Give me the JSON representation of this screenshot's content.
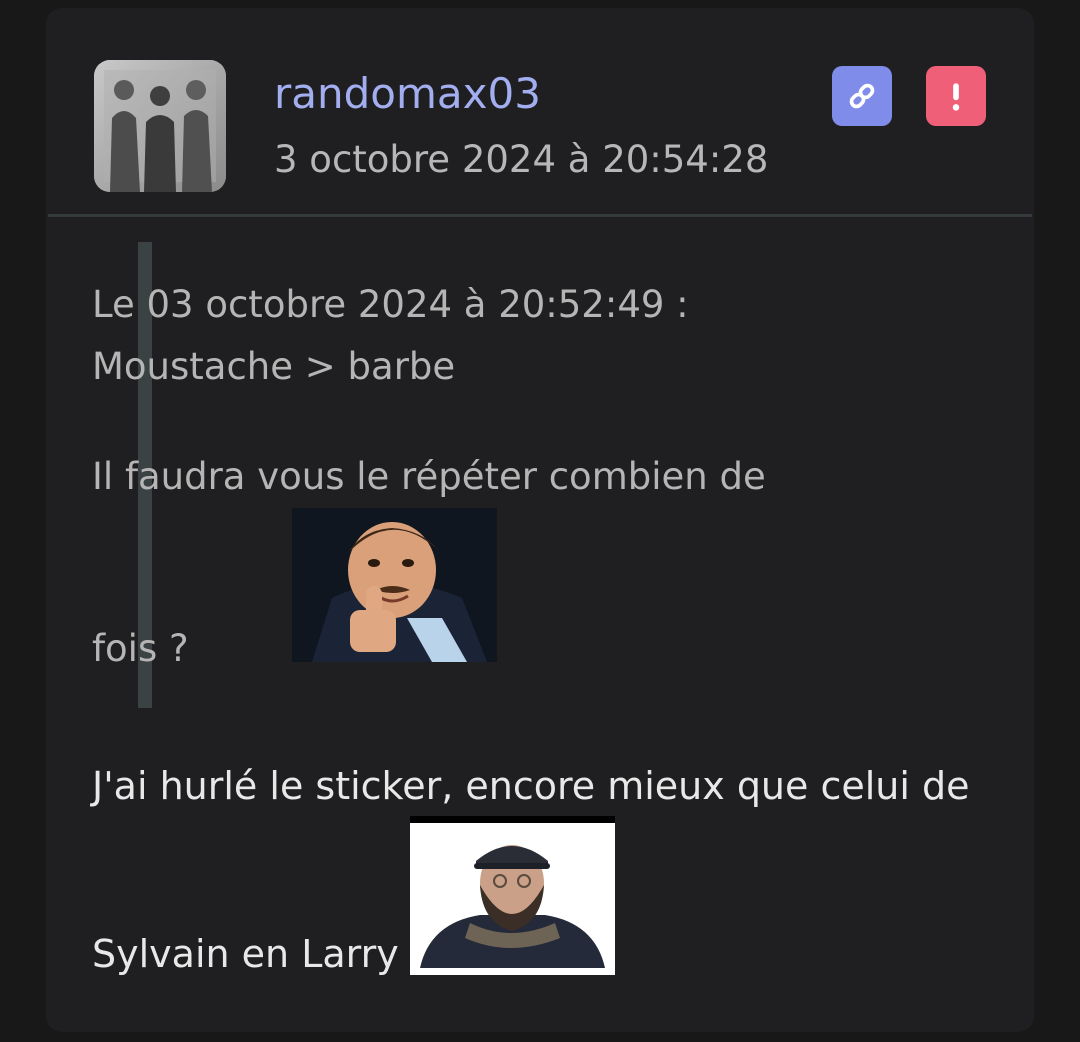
{
  "post": {
    "author": "randomax03",
    "date": "3 octobre 2024 à 20:54:28",
    "quote": {
      "header": "Le 03 octobre 2024 à 20:52:49 :",
      "line1": "Moustache > barbe",
      "line2": "Il faudra vous le répéter combien de",
      "line3": "fois ?"
    },
    "message": {
      "line1": "J'ai hurlé le sticker, encore mieux que celui de",
      "line2": "Sylvain en Larry"
    }
  },
  "icons": {
    "link": "link-icon",
    "report": "exclamation-icon"
  },
  "colors": {
    "background": "#181818",
    "card": "#1f1f21",
    "username": "#a3aef0",
    "link_button": "#7f8ce9",
    "report_button": "#ef6078"
  }
}
